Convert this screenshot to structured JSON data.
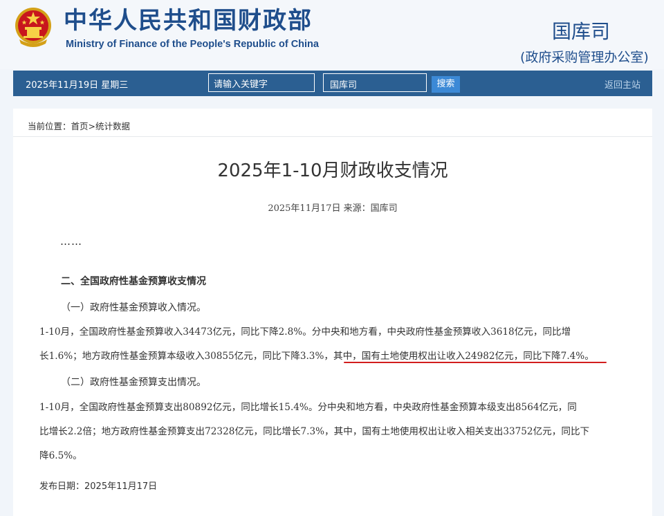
{
  "header": {
    "cn_name": "中华人民共和国财政部",
    "en_name": "Ministry of Finance of the People's Republic of China",
    "dept_name": "国库司",
    "dept_subtitle": "(政府采购管理办公室)",
    "emblem_color": "#c8161d",
    "brand_color": "#1f4e8c"
  },
  "navbar": {
    "date": "2025年11月19日  星期三",
    "search_placeholder": "请输入关键字",
    "dept_select": "国库司",
    "search_button": "搜索",
    "home_link": "返回主站",
    "bar_color": "#2b5f92"
  },
  "breadcrumb": "当前位置：首页>统计数据",
  "article": {
    "title": "2025年1-10月财政收支情况",
    "meta": "2025年11月17日  来源：国库司",
    "ellipsis": "……",
    "section_heading": "二、全国政府性基金预算收支情况",
    "sub1": "（一）政府性基金预算收入情况。",
    "para1": {
      "line1": "1-10月，全国政府性基金预算收入34473亿元，同比下降2.8%。分中央和地方看，中央政府性基金预算收入3618亿元，同比增",
      "line2": "长1.6%；地方政府性基金预算本级收入30855亿元，同比下降3.3%，其中，国有土地使用权出让收入24982亿元，同比下降7.4%。"
    },
    "sub2": "（二）政府性基金预算支出情况。",
    "para2": {
      "line1": "1-10月，全国政府性基金预算支出80892亿元，同比增长15.4%。分中央和地方看，中央政府性基金预算本级支出8564亿元，同",
      "line2": "比增长2.2倍；地方政府性基金预算支出72328亿元，同比增长7.3%，其中，国有土地使用权出让收入相关支出33752亿元，同比下",
      "line3": "降6.5%。"
    },
    "highlight_color": "#d21d1d",
    "publish_date": "发布日期：2025年11月17日"
  }
}
